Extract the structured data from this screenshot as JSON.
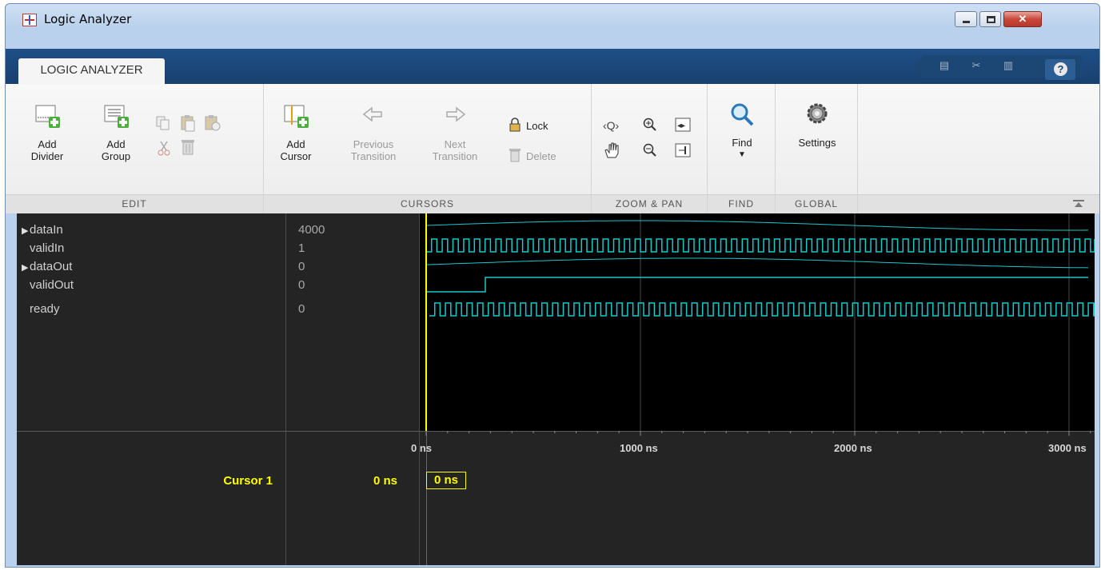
{
  "window": {
    "title": "Logic Analyzer"
  },
  "ribbon": {
    "active_tab": "LOGIC ANALYZER",
    "help_glyph": "?"
  },
  "edit": {
    "add_divider": [
      "Add",
      "Divider"
    ],
    "add_group": [
      "Add",
      "Group"
    ],
    "section": "EDIT"
  },
  "cursors": {
    "add_cursor": [
      "Add",
      "Cursor"
    ],
    "previous": [
      "Previous",
      "Transition"
    ],
    "next": [
      "Next",
      "Transition"
    ],
    "lock": "Lock",
    "delete": "Delete",
    "section": "CURSORS"
  },
  "zoom": {
    "section": "ZOOM & PAN"
  },
  "find": {
    "label": "Find",
    "section": "FIND"
  },
  "global": {
    "settings": "Settings",
    "section": "GLOBAL"
  },
  "signals": [
    {
      "name": "dataIn",
      "value": "4000",
      "expandable": true
    },
    {
      "name": "validIn",
      "value": "1",
      "expandable": false
    },
    {
      "name": "dataOut",
      "value": "0",
      "expandable": true
    },
    {
      "name": "validOut",
      "value": "0",
      "expandable": false
    },
    {
      "name": "ready",
      "value": "0",
      "expandable": false
    }
  ],
  "axis": {
    "ticks": [
      "0 ns",
      "1000 ns",
      "2000 ns",
      "3000 ns"
    ],
    "range_ns": [
      0,
      3100
    ]
  },
  "cursor": {
    "name": "Cursor 1",
    "value": "0 ns",
    "marker": "0 ns"
  },
  "colors": {
    "trace": "#19c8c8",
    "cursor": "#ffff00",
    "grid": "#4a4a4a"
  }
}
